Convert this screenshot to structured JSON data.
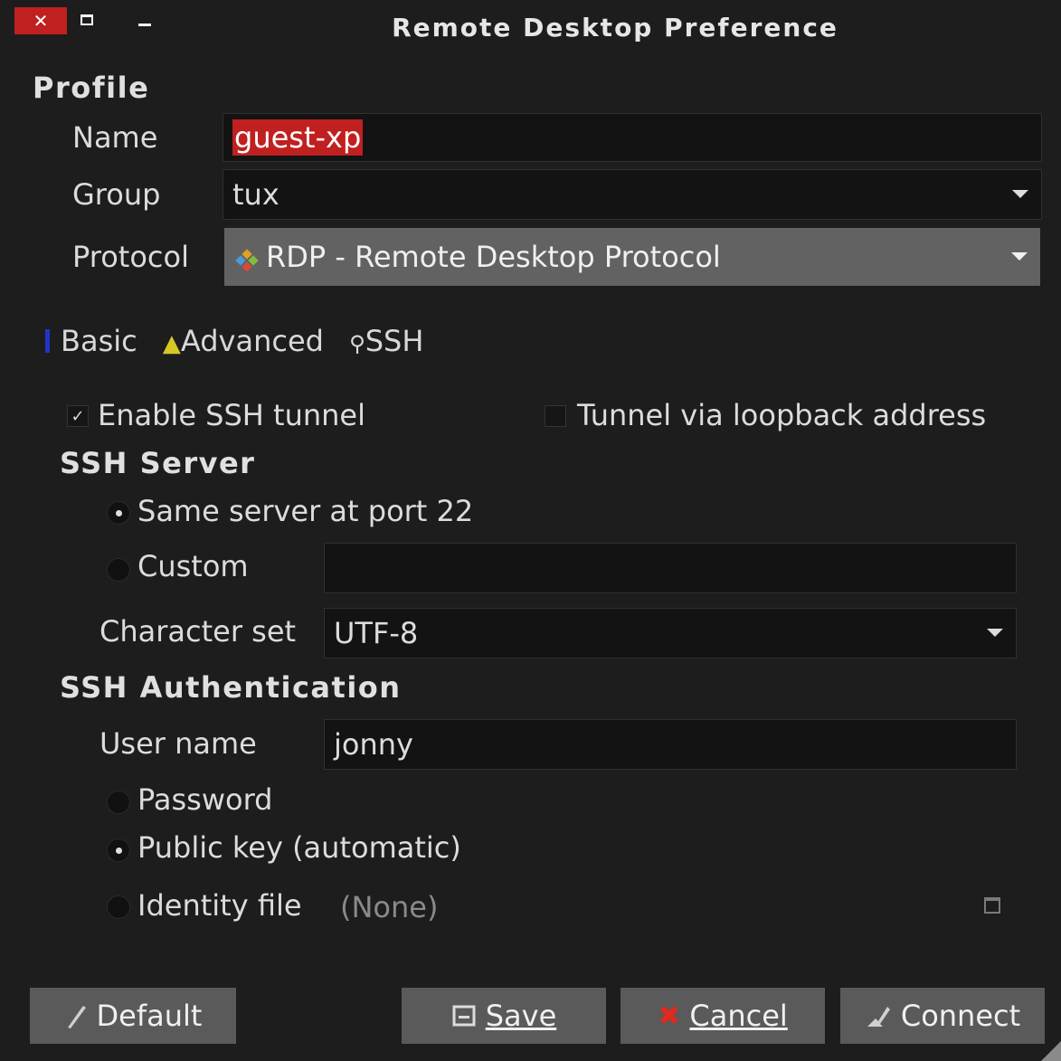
{
  "window": {
    "title": "Remote Desktop Preference",
    "close_glyph": "✕"
  },
  "profile": {
    "section_title": "Profile",
    "name_label": "Name",
    "name_value": "guest-xp",
    "group_label": "Group",
    "group_value": "tux",
    "protocol_label": "Protocol",
    "protocol_value": "RDP - Remote Desktop Protocol"
  },
  "tabs": [
    {
      "label": "Basic",
      "icon": "info-icon"
    },
    {
      "label": "Advanced",
      "icon": "warning-icon"
    },
    {
      "label": "SSH",
      "icon": "key-icon"
    }
  ],
  "ssh": {
    "enable_tunnel_label": "Enable SSH tunnel",
    "enable_tunnel_checked": true,
    "loopback_label": "Tunnel via loopback address",
    "loopback_checked": false,
    "server_section_title": "SSH Server",
    "same_server_label": "Same server at port 22",
    "same_server_selected": true,
    "custom_label": "Custom",
    "custom_value": "",
    "charset_label": "Character set",
    "charset_value": "UTF-8",
    "auth_section_title": "SSH Authentication",
    "username_label": "User name",
    "username_value": "jonny",
    "password_label": "Password",
    "pubkey_label": "Public key (automatic)",
    "pubkey_selected": true,
    "identity_label": "Identity file",
    "identity_value": "(None)"
  },
  "buttons": {
    "default_label": "Default",
    "save_label": "Save",
    "cancel_label": "Cancel",
    "connect_label": "Connect"
  },
  "colors": {
    "accent": "#c0201f",
    "background": "#1d1d1d",
    "button": "#5a5a5a"
  }
}
